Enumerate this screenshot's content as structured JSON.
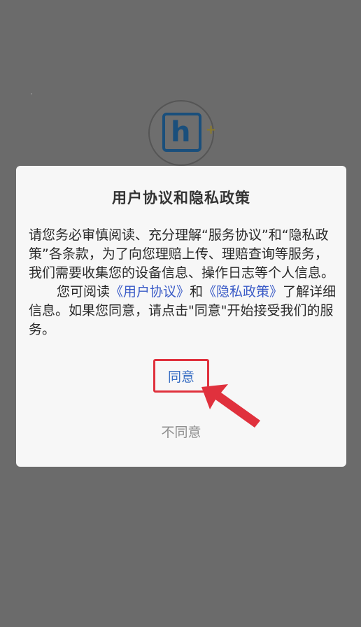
{
  "dialog": {
    "title": "用户协议和隐私政策",
    "para1": "请您务必审慎阅读、充分理解“服务协议”和“隐私政策”各条款，为了向您理赔上传、理赔查询等服务，我们需要收集您的设备信息、操作日志等个人信息。",
    "para2_prefix": "您可阅读",
    "user_agreement_link": "《用户协议》",
    "para2_and": "和",
    "privacy_policy_link": "《隐私政策》",
    "para2_suffix": "了解详细信息。如果您同意，请点击\"同意\"开始接受我们的服务。",
    "agree_label": "同意",
    "disagree_label": "不同意"
  },
  "colors": {
    "overlay": "#6b6b6b",
    "dialog_bg": "#f7f7f7",
    "link": "#3a5bc7",
    "highlight": "#e0313d",
    "logo": "#1a4f7c"
  },
  "icons": {
    "logo": "hi-plus-logo",
    "annotation": "red-arrow-icon"
  }
}
